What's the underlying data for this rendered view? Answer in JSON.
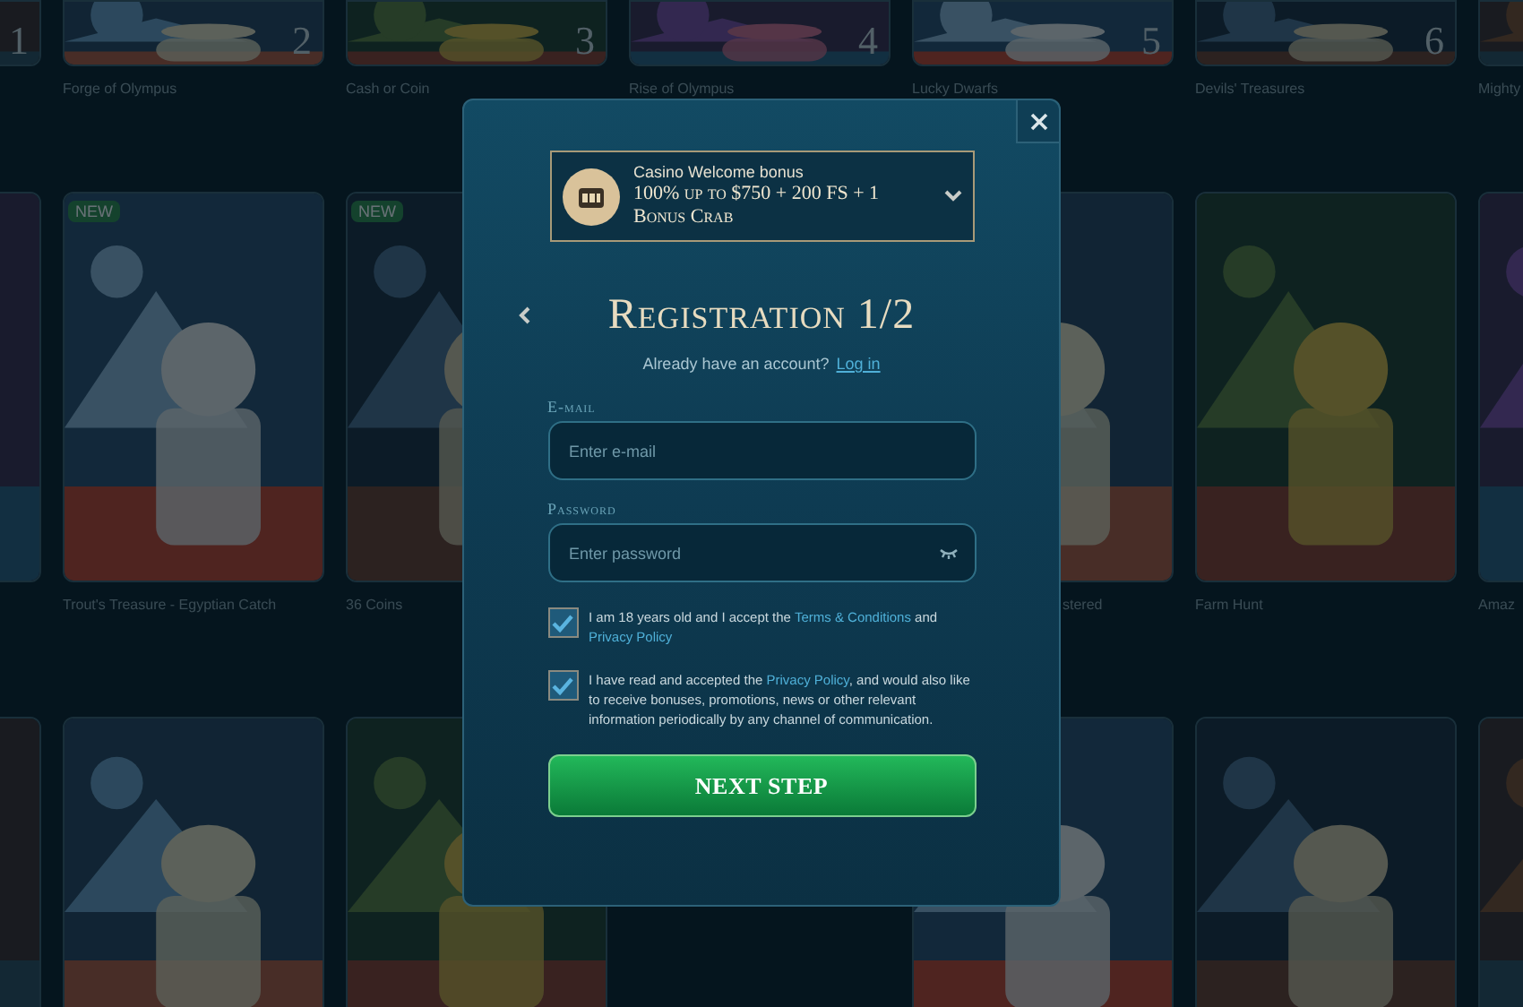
{
  "game_rows": [
    {
      "tiles": [
        {
          "rank": "1"
        },
        {
          "rank": "2",
          "title": "Forge of Olympus"
        },
        {
          "rank": "3",
          "title": "Cash or Coin"
        },
        {
          "rank": "4",
          "title": "Rise of Olympus"
        },
        {
          "rank": "5",
          "title": "Lucky Dwarfs"
        },
        {
          "rank": "6",
          "title": "Devils' Treasures"
        },
        {
          "title": "Mighty"
        }
      ]
    },
    {
      "tiles": [
        {
          "kind": "picture"
        },
        {
          "title": "Trout's Treasure - Egyptian Catch",
          "badge": "NEW"
        },
        {
          "title": "36 Coins",
          "badge": "NEW"
        },
        {
          "kind": "covered"
        },
        {
          "title": "stered"
        },
        {
          "title": "Farm Hunt"
        },
        {
          "title": "Amaz"
        }
      ]
    },
    {
      "tiles": [
        {
          "kind": "picture"
        },
        {
          "kind": "picture"
        },
        {
          "kind": "picture"
        },
        {
          "kind": "covered"
        },
        {
          "kind": "picture"
        },
        {
          "kind": "picture"
        },
        {
          "kind": "picture"
        }
      ]
    }
  ],
  "modal": {
    "bonus": {
      "label": "Casino Welcome bonus",
      "offer": "100% up to $750 + 200 FS + 1 Bonus Crab"
    },
    "title": "Registration 1/2",
    "login_prompt": {
      "text": "Already have an account?",
      "link": "Log in"
    },
    "fields": [
      {
        "label": "E-mail",
        "placeholder": "Enter e-mail",
        "kind": "email"
      },
      {
        "label": "Password",
        "placeholder": "Enter password",
        "kind": "password"
      }
    ],
    "consents": [
      {
        "checked": true,
        "parts": [
          {
            "text": "I am 18 years old and I accept the "
          },
          {
            "link": "Terms & Conditions"
          },
          {
            "text": " and "
          },
          {
            "link": "Privacy Policy"
          }
        ]
      },
      {
        "checked": true,
        "parts": [
          {
            "text": "I have read and accepted the "
          },
          {
            "link": "Privacy Policy"
          },
          {
            "text": ", and would also like to receive bonuses, promotions, news or other relevant information periodically by any channel of communication."
          }
        ]
      }
    ],
    "submit": "NEXT STEP"
  }
}
